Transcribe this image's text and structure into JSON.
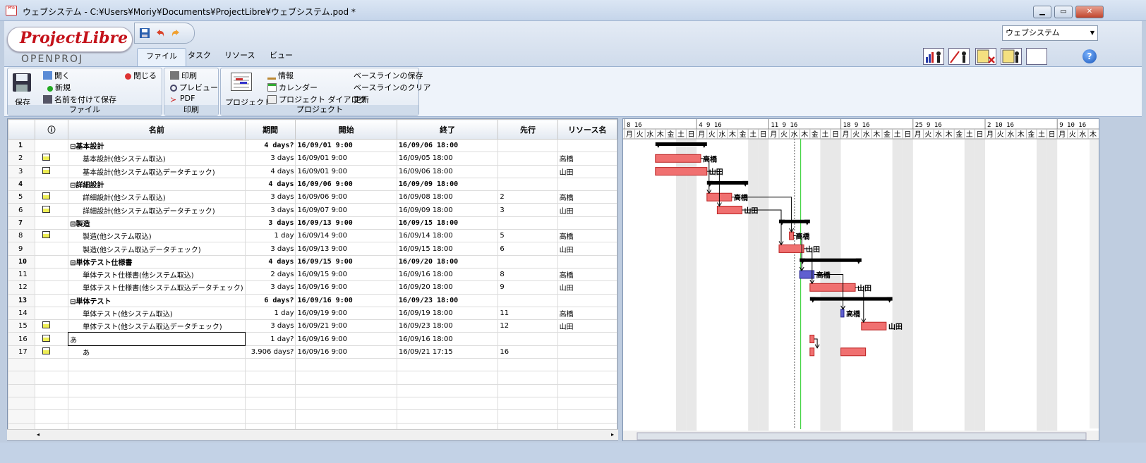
{
  "window": {
    "title": "ウェブシステム - C:¥Users¥Moriy¥Documents¥ProjectLibre¥ウェブシステム.pod *",
    "minimize": "▁",
    "maximize": "▭",
    "close": "✕"
  },
  "logo": {
    "main": "ProjectLibre",
    "tm": "TM",
    "sub": "OPENPROJ"
  },
  "tabs": [
    {
      "label": "ファイル"
    },
    {
      "label": "タスク"
    },
    {
      "label": "リソース"
    },
    {
      "label": "ビュー"
    }
  ],
  "project_selector": {
    "value": "ウェブシステム",
    "arrow": "▼"
  },
  "help": "?",
  "ribbon": {
    "file": {
      "label": "ファイル",
      "save": "保存",
      "open": "開く",
      "new": "新規",
      "saveas": "名前を付けて保存",
      "close": "閉じる"
    },
    "print": {
      "label": "印刷",
      "print": "印刷",
      "preview": "プレビュー",
      "pdf": "PDF"
    },
    "project": {
      "label": "プロジェクト",
      "project": "プロジェクト",
      "info": "情報",
      "calendar": "カレンダー",
      "dialog": "プロジェクト ダイアログ",
      "baseline_save": "ベースラインの保存",
      "baseline_clear": "ベースラインのクリア",
      "update": "更新"
    }
  },
  "table": {
    "headers": {
      "info": "ⓘ",
      "name": "名前",
      "duration": "期間",
      "start": "開始",
      "finish": "終了",
      "predecessor": "先行",
      "resource": "リソース名"
    },
    "rows": [
      {
        "id": "1",
        "ico": false,
        "sum": true,
        "name": "⊟基本設計",
        "dur": "4 days?",
        "start": "16/09/01 9:00",
        "end": "16/09/06 18:00",
        "pred": "",
        "res": ""
      },
      {
        "id": "2",
        "ico": true,
        "sum": false,
        "name": "基本設計(他システム取込)",
        "dur": "3 days",
        "start": "16/09/01 9:00",
        "end": "16/09/05 18:00",
        "pred": "",
        "res": "高橋"
      },
      {
        "id": "3",
        "ico": true,
        "sum": false,
        "name": "基本設計(他システム取込データチェック)",
        "dur": "4 days",
        "start": "16/09/01 9:00",
        "end": "16/09/06 18:00",
        "pred": "",
        "res": "山田"
      },
      {
        "id": "4",
        "ico": false,
        "sum": true,
        "name": "⊟詳細設計",
        "dur": "4 days",
        "start": "16/09/06 9:00",
        "end": "16/09/09 18:00",
        "pred": "",
        "res": ""
      },
      {
        "id": "5",
        "ico": true,
        "sum": false,
        "name": "詳細設計(他システム取込)",
        "dur": "3 days",
        "start": "16/09/06 9:00",
        "end": "16/09/08 18:00",
        "pred": "2",
        "res": "高橋"
      },
      {
        "id": "6",
        "ico": true,
        "sum": false,
        "name": "詳細設計(他システム取込データチェック)",
        "dur": "3 days",
        "start": "16/09/07 9:00",
        "end": "16/09/09 18:00",
        "pred": "3",
        "res": "山田"
      },
      {
        "id": "7",
        "ico": false,
        "sum": true,
        "name": "⊟製造",
        "dur": "3 days",
        "start": "16/09/13 9:00",
        "end": "16/09/15 18:00",
        "pred": "",
        "res": ""
      },
      {
        "id": "8",
        "ico": true,
        "sum": false,
        "name": "製造(他システム取込)",
        "dur": "1 day",
        "start": "16/09/14 9:00",
        "end": "16/09/14 18:00",
        "pred": "5",
        "res": "高橋"
      },
      {
        "id": "9",
        "ico": false,
        "sum": false,
        "name": "製造(他システム取込データチェック)",
        "dur": "3 days",
        "start": "16/09/13 9:00",
        "end": "16/09/15 18:00",
        "pred": "6",
        "res": "山田"
      },
      {
        "id": "10",
        "ico": false,
        "sum": true,
        "name": "⊟単体テスト仕様書",
        "dur": "4 days",
        "start": "16/09/15 9:00",
        "end": "16/09/20 18:00",
        "pred": "",
        "res": ""
      },
      {
        "id": "11",
        "ico": false,
        "sum": false,
        "name": "単体テスト仕様書(他システム取込)",
        "dur": "2 days",
        "start": "16/09/15 9:00",
        "end": "16/09/16 18:00",
        "pred": "8",
        "res": "高橋"
      },
      {
        "id": "12",
        "ico": false,
        "sum": false,
        "name": "単体テスト仕様書(他システム取込データチェック)",
        "dur": "3 days",
        "start": "16/09/16 9:00",
        "end": "16/09/20 18:00",
        "pred": "9",
        "res": "山田"
      },
      {
        "id": "13",
        "ico": false,
        "sum": true,
        "name": "⊟単体テスト",
        "dur": "6 days?",
        "start": "16/09/16 9:00",
        "end": "16/09/23 18:00",
        "pred": "",
        "res": ""
      },
      {
        "id": "14",
        "ico": false,
        "sum": false,
        "name": "単体テスト(他システム取込)",
        "dur": "1 day",
        "start": "16/09/19 9:00",
        "end": "16/09/19 18:00",
        "pred": "11",
        "res": "高橋"
      },
      {
        "id": "15",
        "ico": true,
        "sum": false,
        "name": "単体テスト(他システム取込データチェック)",
        "dur": "3 days",
        "start": "16/09/21 9:00",
        "end": "16/09/23 18:00",
        "pred": "12",
        "res": "山田"
      },
      {
        "id": "16",
        "ico": true,
        "sum": false,
        "name": "あ",
        "dur": "1 day?",
        "start": "16/09/16 9:00",
        "end": "16/09/16 18:00",
        "pred": "",
        "res": ""
      },
      {
        "id": "17",
        "ico": true,
        "sum": false,
        "name": "あ",
        "dur": "3.906 days?",
        "start": "16/09/16 9:00",
        "end": "16/09/21 17:15",
        "pred": "16",
        "res": ""
      }
    ]
  },
  "gantt": {
    "weeks": [
      "8 16",
      "4 9 16",
      "11 9 16",
      "18 9 16",
      "25 9 16",
      "2 10 16",
      "9 10 16"
    ],
    "days": [
      "月",
      "火",
      "水",
      "木",
      "金",
      "土",
      "日"
    ],
    "labels": [
      "高橋",
      "山田",
      "高橋",
      "山田",
      "高橋",
      "山田",
      "高橋",
      "山田",
      "高橋",
      "山田"
    ]
  },
  "colors": {
    "bar": "#f07070",
    "bar_alt": "#6060d0",
    "summary": "#000000"
  }
}
